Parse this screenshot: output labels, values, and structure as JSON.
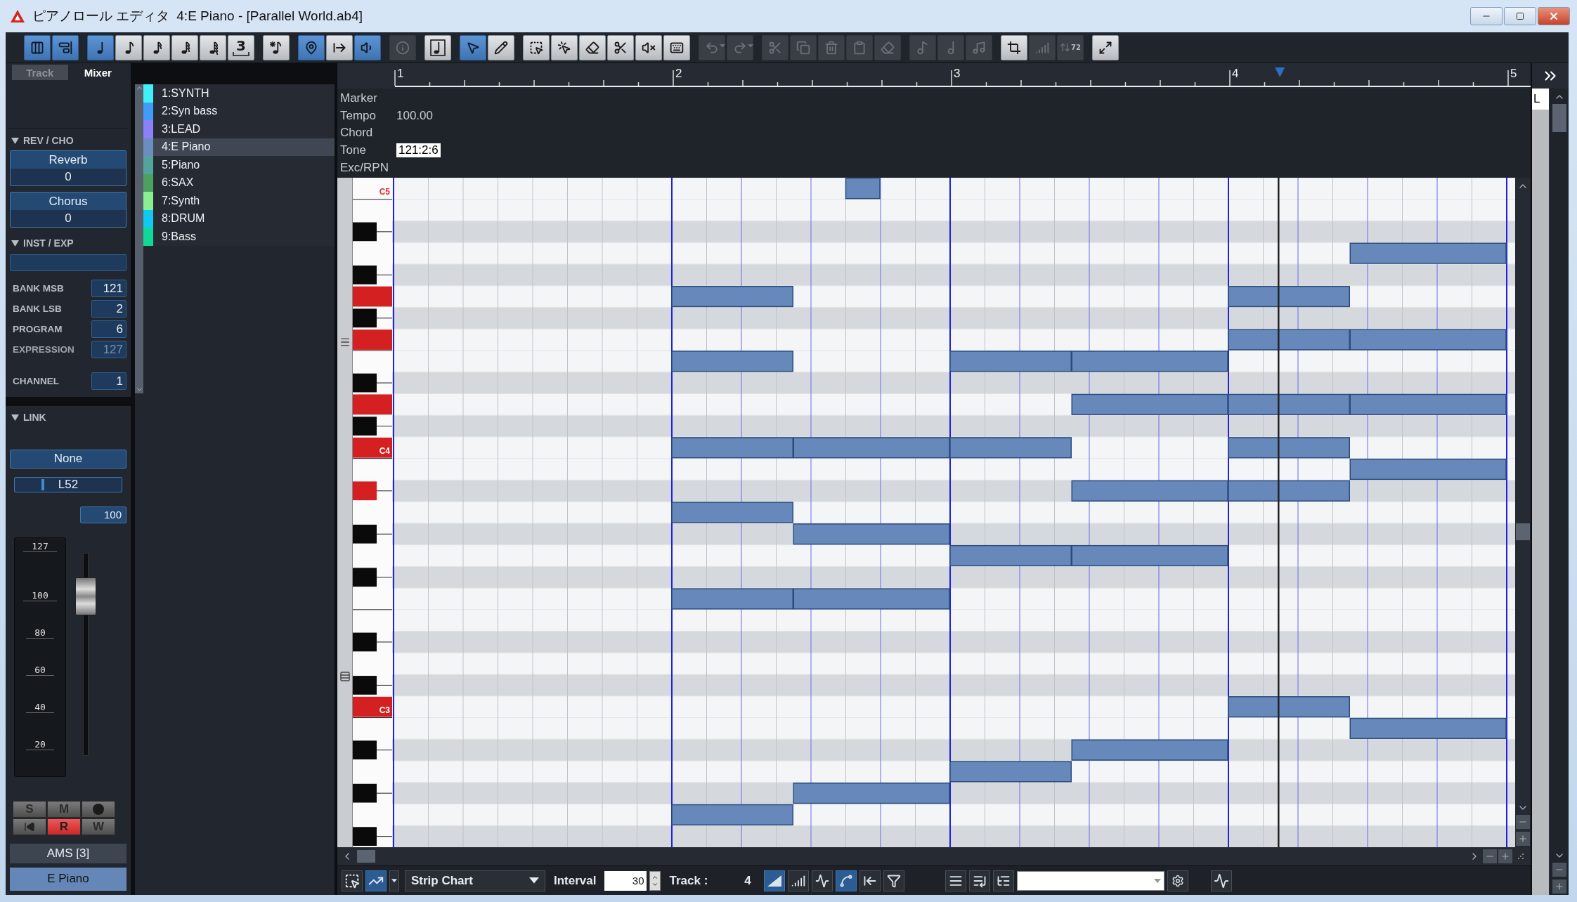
{
  "window": {
    "title": "ピアノロール エディタ",
    "document": "4:E Piano - [Parallel World.ab4]"
  },
  "toolbar": [
    {
      "buttons": [
        {
          "kind": "grid",
          "selected": true,
          "disabled": false
        },
        {
          "kind": "snap",
          "selected": true,
          "disabled": false
        }
      ]
    },
    {
      "buttons": [
        {
          "kind": "quarter",
          "selected": true,
          "disabled": false
        },
        {
          "kind": "eighth",
          "selected": false,
          "disabled": false
        },
        {
          "kind": "sixteenth",
          "selected": false,
          "disabled": false
        },
        {
          "kind": "thirty-second",
          "selected": false,
          "disabled": false
        },
        {
          "kind": "sixty-fourth",
          "selected": false,
          "disabled": false
        },
        {
          "kind": "triplet",
          "label": "3",
          "selected": false,
          "disabled": false
        }
      ]
    },
    {
      "buttons": [
        {
          "kind": "dotted",
          "selected": false,
          "disabled": false
        }
      ]
    },
    {
      "buttons": [
        {
          "kind": "marker",
          "selected": true,
          "disabled": false
        },
        {
          "kind": "jump",
          "selected": false,
          "disabled": false
        },
        {
          "kind": "audition",
          "selected": true,
          "disabled": false
        }
      ]
    },
    {
      "buttons": [
        {
          "kind": "info",
          "selected": false,
          "disabled": true
        }
      ]
    },
    {
      "buttons": [
        {
          "kind": "note-box",
          "selected": false,
          "disabled": false
        }
      ]
    },
    {
      "buttons": [
        {
          "kind": "pointer",
          "selected": true,
          "disabled": false
        },
        {
          "kind": "pencil",
          "selected": false,
          "disabled": false
        }
      ]
    },
    {
      "buttons": [
        {
          "kind": "select-rect",
          "selected": false,
          "disabled": false
        },
        {
          "kind": "note-select",
          "selected": false,
          "disabled": false
        },
        {
          "kind": "eraser",
          "selected": false,
          "disabled": false
        },
        {
          "kind": "scissors",
          "selected": false,
          "disabled": false
        },
        {
          "kind": "mute",
          "selected": false,
          "disabled": false
        },
        {
          "kind": "keyboard",
          "selected": false,
          "disabled": false
        }
      ]
    },
    {
      "buttons": [
        {
          "kind": "undo",
          "menu": true,
          "selected": false,
          "disabled": true
        },
        {
          "kind": "redo",
          "menu": true,
          "selected": false,
          "disabled": true
        }
      ]
    },
    {
      "buttons": [
        {
          "kind": "cut",
          "selected": false,
          "disabled": true
        },
        {
          "kind": "copy",
          "selected": false,
          "disabled": true
        },
        {
          "kind": "delete",
          "selected": false,
          "disabled": true
        },
        {
          "kind": "paste",
          "selected": false,
          "disabled": true
        },
        {
          "kind": "erase",
          "selected": false,
          "disabled": true
        }
      ]
    },
    {
      "buttons": [
        {
          "kind": "tie",
          "selected": false,
          "disabled": true
        },
        {
          "kind": "note-plus",
          "selected": false,
          "disabled": true
        },
        {
          "kind": "note-minus",
          "selected": false,
          "disabled": true
        }
      ]
    },
    {
      "buttons": [
        {
          "kind": "quantize",
          "selected": false,
          "disabled": false
        },
        {
          "kind": "bars",
          "selected": false,
          "disabled": true
        },
        {
          "kind": "numbered",
          "label": "72",
          "selected": false,
          "disabled": true
        }
      ]
    },
    {
      "buttons": [
        {
          "kind": "expand",
          "selected": false,
          "disabled": false
        }
      ]
    }
  ],
  "left_panel": {
    "tabs": [
      {
        "label": "Track",
        "selected": false
      },
      {
        "label": "Mixer",
        "selected": true
      }
    ],
    "rev_cho": {
      "title": "REV / CHO",
      "expanded": true,
      "sends": [
        {
          "label": "Reverb",
          "value": "0"
        },
        {
          "label": "Chorus",
          "value": "0"
        }
      ]
    },
    "inst_exp": {
      "title": "INST / EXP",
      "expanded": true,
      "params": [
        {
          "label": "BANK MSB",
          "value": "121",
          "disabled": false
        },
        {
          "label": "BANK LSB",
          "value": "2",
          "disabled": false
        },
        {
          "label": "PROGRAM",
          "value": "6",
          "disabled": false
        },
        {
          "label": "EXPRESSION",
          "value": "127",
          "disabled": true
        },
        {
          "label": "CHANNEL",
          "value": "1",
          "disabled": false
        }
      ]
    },
    "link": {
      "title": "LINK",
      "expanded": true,
      "value": "None"
    },
    "pan": {
      "reading": "L52",
      "level": 0.25
    },
    "velocity": "100",
    "fader": {
      "scale": [
        "127",
        "100",
        "80",
        "60",
        "40",
        "20"
      ],
      "level": 0.787
    },
    "buttons": [
      {
        "kind": "letter",
        "label": "S",
        "on": false
      },
      {
        "kind": "letter",
        "label": "M",
        "on": false
      },
      {
        "kind": "record",
        "on": false
      },
      {
        "kind": "playback",
        "on": false
      },
      {
        "kind": "letter",
        "label": "R",
        "on": true
      },
      {
        "kind": "letter",
        "label": "W",
        "on": false
      }
    ],
    "ams": "AMS [3]",
    "instrument": "E Piano"
  },
  "tracks": [
    {
      "name": "1:SYNTH",
      "color": "#3ff0f8",
      "selected": false
    },
    {
      "name": "2:Syn bass",
      "color": "#3f9cf8",
      "selected": false
    },
    {
      "name": "3:LEAD",
      "color": "#8a80f8",
      "selected": false
    },
    {
      "name": "4:E Piano",
      "color": "#6a8ec0",
      "selected": true
    },
    {
      "name": "5:Piano",
      "color": "#52a49c",
      "selected": false
    },
    {
      "name": "6:SAX",
      "color": "#4ca060",
      "selected": false
    },
    {
      "name": "7:Synth",
      "color": "#88f090",
      "selected": false
    },
    {
      "name": "8:DRUM",
      "color": "#10c8f0",
      "selected": false
    },
    {
      "name": "9:Bass",
      "color": "#10d898",
      "selected": false
    }
  ],
  "ruler": {
    "measures": [
      "1",
      "2",
      "3",
      "4",
      "5"
    ]
  },
  "info_rows": [
    {
      "kind": "empty",
      "label": "Marker"
    },
    {
      "kind": "text",
      "label": "Tempo",
      "value": "100.00"
    },
    {
      "kind": "empty",
      "label": "Chord"
    },
    {
      "kind": "field",
      "label": "Tone",
      "value": "121:2:6"
    },
    {
      "kind": "empty",
      "label": "Exc/RPN"
    }
  ],
  "keyboard": {
    "labels": [
      "C5",
      "C4",
      "C3"
    ]
  },
  "side_list": {
    "header": "L"
  },
  "bottom_bar": {
    "tools": [
      {
        "kind": "marquee",
        "selected": false
      },
      {
        "kind": "line",
        "selected": true
      }
    ],
    "chart_type": "Strip Chart",
    "interval_label": "Interval",
    "interval": "30",
    "track_label": "Track :",
    "track": "4",
    "curve_tools": [
      {
        "kind": "ramp",
        "selected": true
      },
      {
        "kind": "bars",
        "selected": false
      },
      {
        "kind": "step",
        "selected": false
      },
      {
        "kind": "curve",
        "selected": true
      },
      {
        "kind": "jump-start",
        "selected": false
      },
      {
        "kind": "filter",
        "selected": false
      }
    ],
    "list_tools": [
      {
        "kind": "list"
      },
      {
        "kind": "list-split"
      },
      {
        "kind": "list-tree"
      }
    ]
  }
}
